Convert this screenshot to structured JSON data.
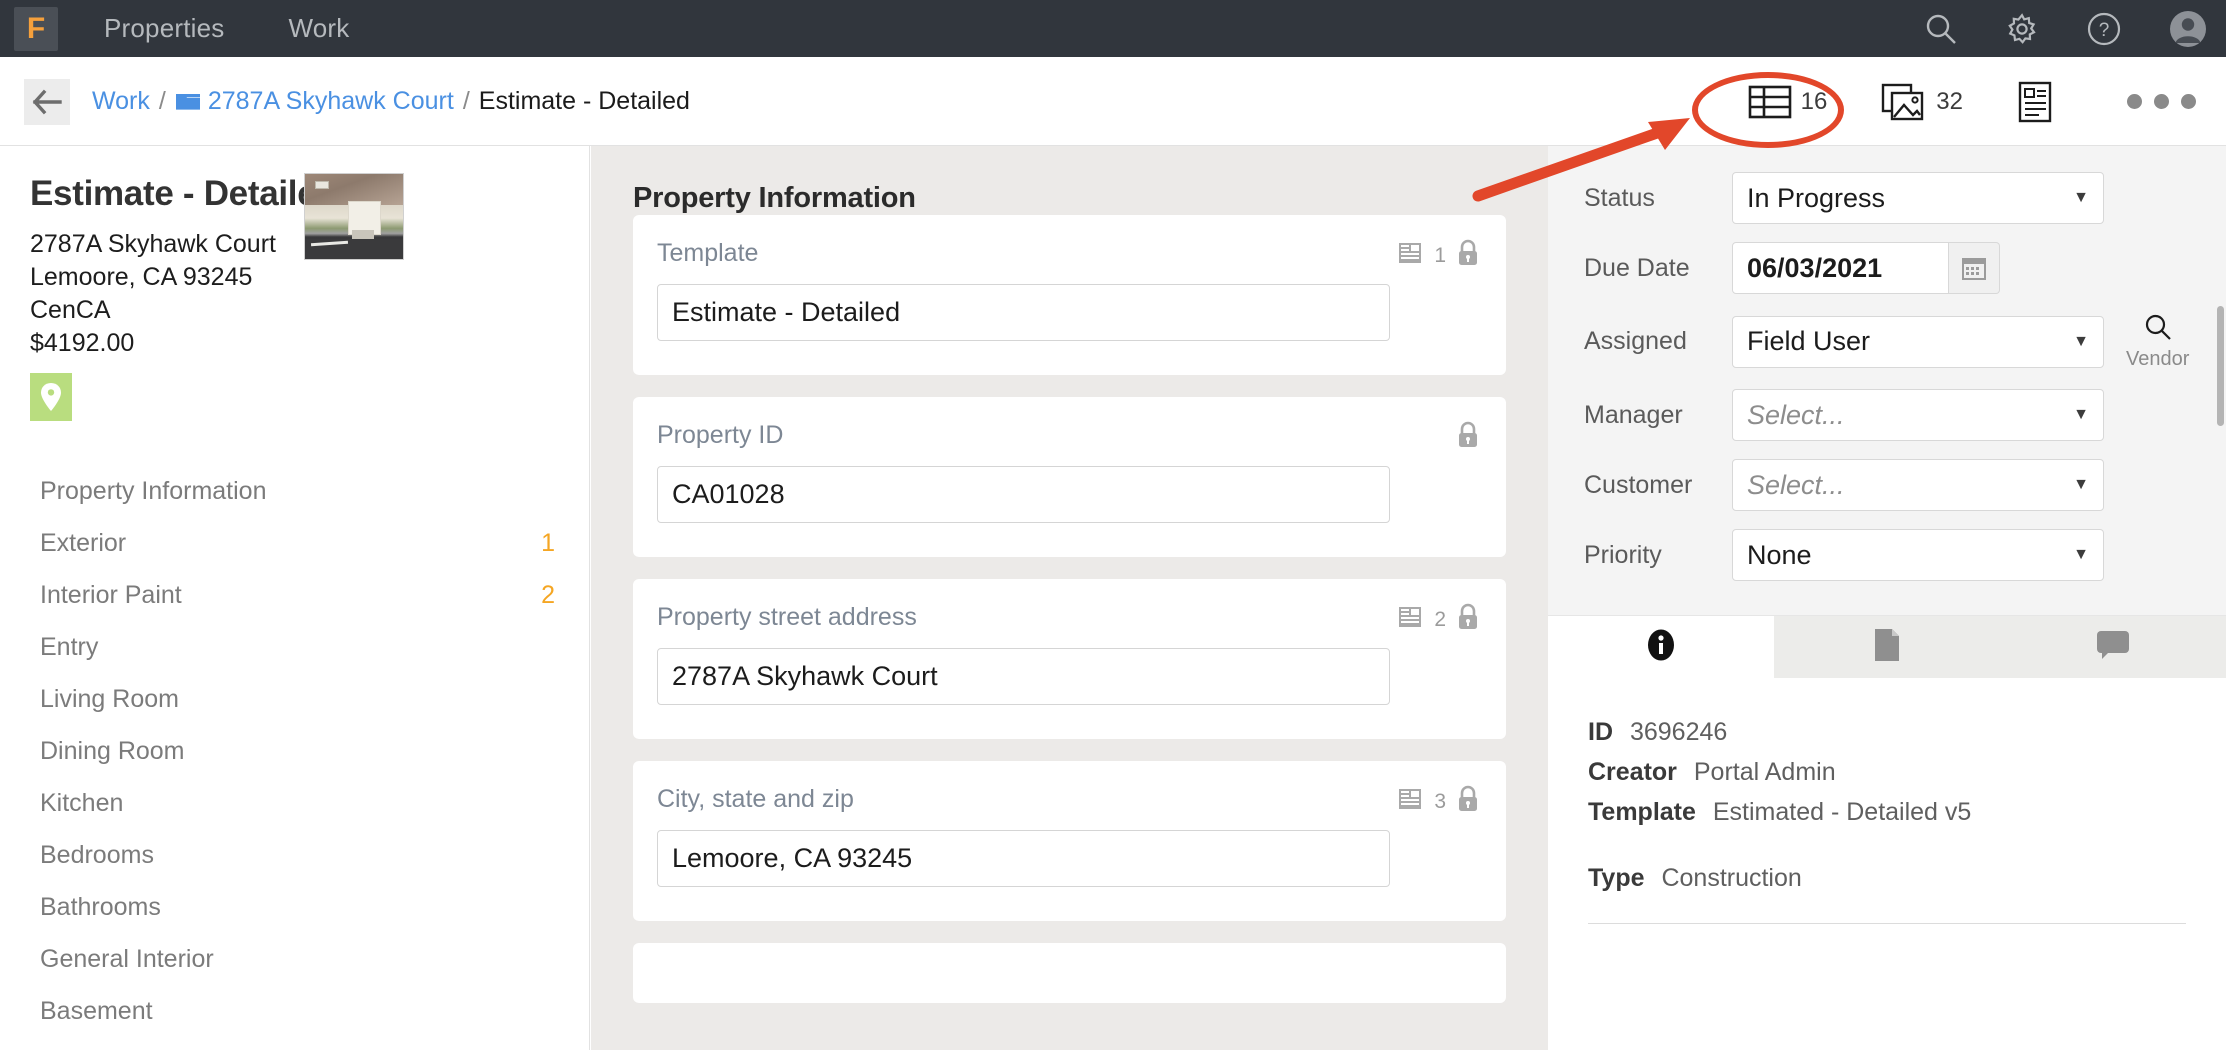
{
  "navbar": {
    "logo_letter": "F",
    "links": [
      "Properties",
      "Work"
    ],
    "icons": [
      "search-icon",
      "gear-icon",
      "help-icon",
      "avatar-icon"
    ]
  },
  "breadcrumb": {
    "back": "back-arrow-icon",
    "items": [
      {
        "label": "Work",
        "type": "link"
      },
      {
        "label": "2787A Skyhawk Court",
        "type": "link",
        "icon": "folder-icon"
      },
      {
        "label": "Estimate - Detailed",
        "type": "current"
      }
    ],
    "separator": "/",
    "actions": [
      {
        "name": "table-view",
        "count": "16",
        "highlighted": true
      },
      {
        "name": "photos-view",
        "count": "32",
        "highlighted": false
      },
      {
        "name": "report-view",
        "count": "",
        "highlighted": false
      },
      {
        "name": "more-options",
        "count": "",
        "highlighted": false
      }
    ]
  },
  "annotation": {
    "color": "#e2472a",
    "shape": "ellipse-and-arrow",
    "target": "table-view-icon"
  },
  "sidebar": {
    "title": "Estimate - Detailed",
    "address_line1": "2787A Skyhawk Court",
    "address_line2": "Lemoore, CA 93245",
    "region": "CenCA",
    "amount": "$4192.00",
    "map_pin": "location-pin-icon",
    "items": [
      {
        "label": "Property Information",
        "badge": ""
      },
      {
        "label": "Exterior",
        "badge": "1"
      },
      {
        "label": "Interior Paint",
        "badge": "2"
      },
      {
        "label": "Entry",
        "badge": ""
      },
      {
        "label": "Living Room",
        "badge": ""
      },
      {
        "label": "Dining Room",
        "badge": ""
      },
      {
        "label": "Kitchen",
        "badge": ""
      },
      {
        "label": "Bedrooms",
        "badge": ""
      },
      {
        "label": "Bathrooms",
        "badge": ""
      },
      {
        "label": "General Interior",
        "badge": ""
      },
      {
        "label": "Basement",
        "badge": ""
      }
    ],
    "badge_color": "#f5a623"
  },
  "main": {
    "section_title": "Property Information",
    "fields": [
      {
        "label": "Template",
        "value": "Estimate - Detailed",
        "note_count": "1",
        "locked": true
      },
      {
        "label": "Property ID",
        "value": "CA01028",
        "note_count": "",
        "locked": true
      },
      {
        "label": "Property street address",
        "value": "2787A Skyhawk Court",
        "note_count": "2",
        "locked": true
      },
      {
        "label": "City, state and zip",
        "value": "Lemoore, CA 93245",
        "note_count": "3",
        "locked": true
      }
    ]
  },
  "right_panel": {
    "fields": [
      {
        "label": "Status",
        "value": "In Progress",
        "type": "select",
        "placeholder": false
      },
      {
        "label": "Due Date",
        "value": "06/03/2021",
        "type": "date"
      },
      {
        "label": "Assigned",
        "value": "Field User",
        "type": "select",
        "placeholder": false,
        "side_action": "Vendor"
      },
      {
        "label": "Manager",
        "value": "Select...",
        "type": "select",
        "placeholder": true
      },
      {
        "label": "Customer",
        "value": "Select...",
        "type": "select",
        "placeholder": true
      },
      {
        "label": "Priority",
        "value": "None",
        "type": "select",
        "placeholder": false
      }
    ],
    "tabs": [
      {
        "name": "info-tab",
        "icon": "info-icon",
        "active": true
      },
      {
        "name": "documents-tab",
        "icon": "document-icon",
        "active": false
      },
      {
        "name": "comments-tab",
        "icon": "comment-icon",
        "active": false
      }
    ],
    "info": {
      "id_label": "ID",
      "id_value": "3696246",
      "creator_label": "Creator",
      "creator_value": "Portal Admin",
      "template_label": "Template",
      "template_value": "Estimated - Detailed v5",
      "type_label": "Type",
      "type_value": "Construction"
    }
  }
}
